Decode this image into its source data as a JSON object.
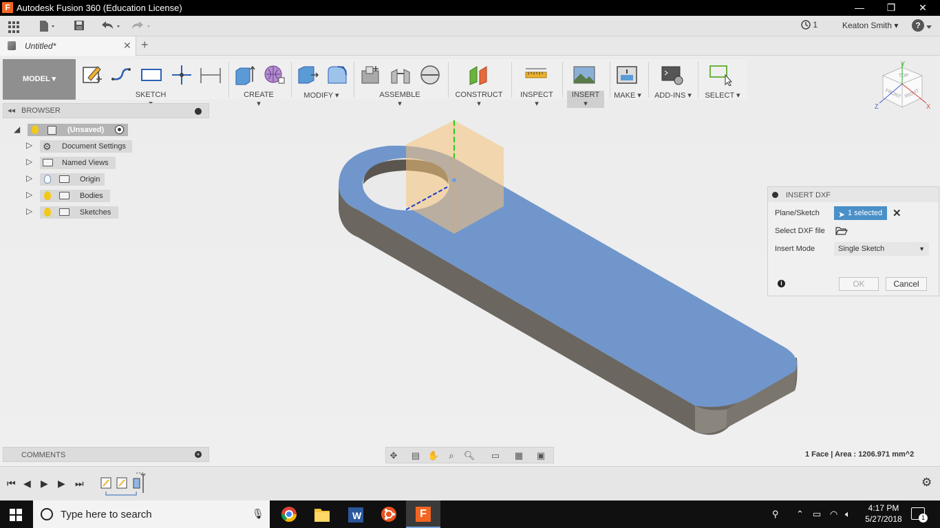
{
  "window": {
    "title": "Autodesk Fusion 360 (Education License)",
    "app_icon": "F",
    "controls": [
      "—",
      "❐",
      "✕"
    ]
  },
  "qa": {
    "job_count": "1",
    "user": "Keaton Smith ▾",
    "help": "?"
  },
  "tab": {
    "name": "Untitled*",
    "close": "✕",
    "new": "+"
  },
  "toolbar": {
    "workspace": "MODEL ▾",
    "groups": {
      "sketch": "SKETCH ▾",
      "create": "CREATE ▾",
      "modify": "MODIFY ▾",
      "assemble": "ASSEMBLE ▾",
      "construct": "CONSTRUCT ▾",
      "inspect": "INSPECT ▾",
      "insert": "INSERT ▾",
      "make": "MAKE ▾",
      "addins": "ADD-INS ▾",
      "select": "SELECT ▾"
    }
  },
  "browser": {
    "title": "BROWSER",
    "root": "(Unsaved)",
    "items": [
      {
        "label": "Document Settings"
      },
      {
        "label": "Named Views"
      },
      {
        "label": "Origin"
      },
      {
        "label": "Bodies"
      },
      {
        "label": "Sketches"
      }
    ]
  },
  "viewcube": {
    "top": "TOP",
    "front": "FRONT",
    "right": "RIGHT",
    "x": "X",
    "y": "Y",
    "z": "Z"
  },
  "dialog": {
    "title": "INSERT DXF",
    "plane_label": "Plane/Sketch",
    "plane_value": "1 selected",
    "file_label": "Select DXF file",
    "mode_label": "Insert Mode",
    "mode_value": "Single Sketch",
    "ok": "OK",
    "cancel": "Cancel",
    "info": "i"
  },
  "comments": {
    "title": "COMMENTS"
  },
  "status": {
    "text": "1 Face | Area : 1206.971 mm^2"
  },
  "taskbar": {
    "search_placeholder": "Type here to search",
    "time": "4:17 PM",
    "date": "5/27/2018",
    "notifications": "1"
  },
  "colors": {
    "face_blue": "#7096cc",
    "side_gray": "#6b6760",
    "plane_orange": "#f5c27a",
    "axis_green": "#22cc22",
    "selection_blue": "#4a90c8"
  }
}
